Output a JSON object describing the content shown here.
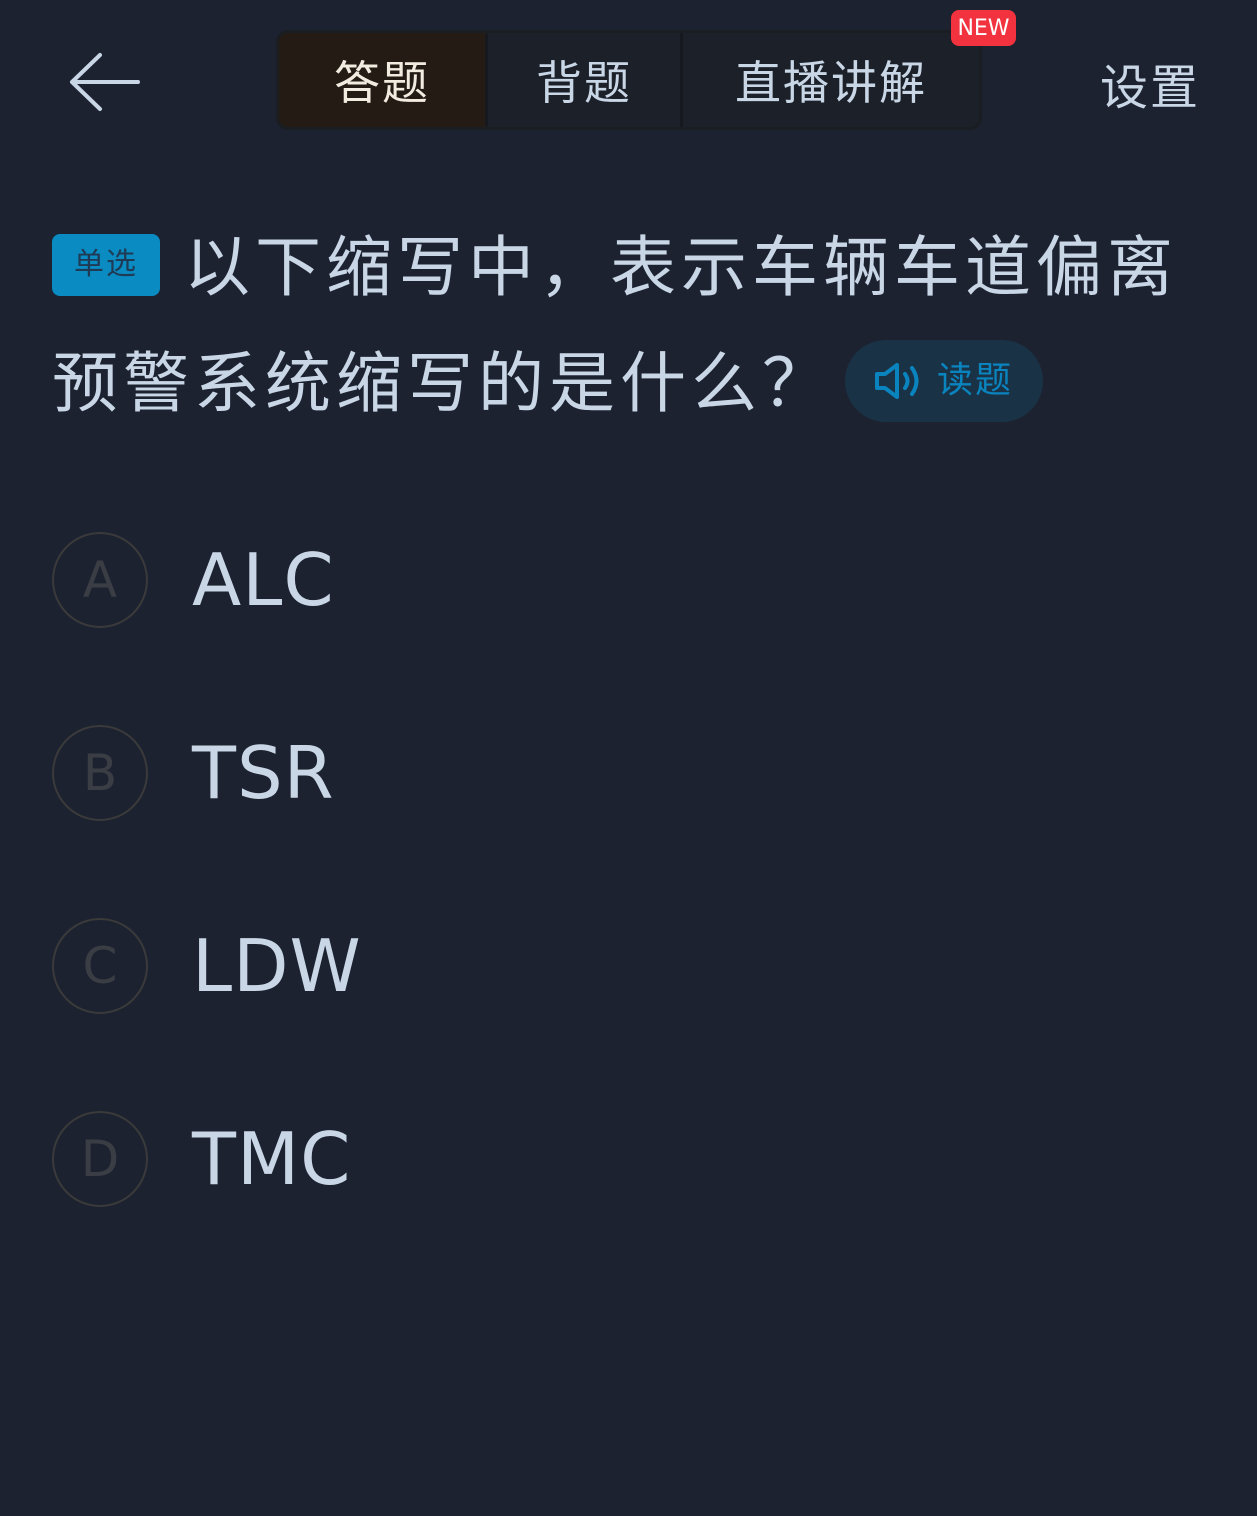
{
  "header": {
    "back_icon": "arrow-left-icon",
    "tabs": [
      {
        "label": "答题",
        "active": true
      },
      {
        "label": "背题",
        "active": false
      },
      {
        "label": "直播讲解",
        "active": false
      }
    ],
    "new_badge": "NEW",
    "settings_label": "设置"
  },
  "question": {
    "type_badge": "单选",
    "text": "以下缩写中，表示车辆车道偏离预警系统缩写的是什么？",
    "read_button": {
      "icon": "speaker-icon",
      "label": "读题"
    }
  },
  "options": [
    {
      "letter": "A",
      "text": "ALC"
    },
    {
      "letter": "B",
      "text": "TSR"
    },
    {
      "letter": "C",
      "text": "LDW"
    },
    {
      "letter": "D",
      "text": "TMC"
    }
  ],
  "colors": {
    "background": "#1c2230",
    "text": "#c9d6e6",
    "accent_blue": "#0a8bc2",
    "new_badge": "#f2323f",
    "active_tab": "#231b14"
  }
}
